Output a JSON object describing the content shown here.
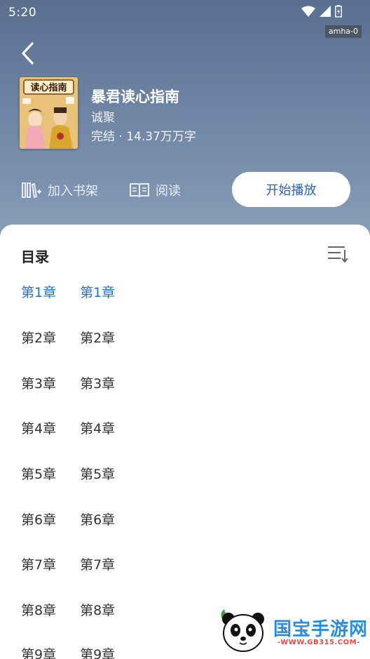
{
  "status": {
    "time": "5:20",
    "device_badge": "amha-0"
  },
  "book": {
    "title": "暴君读心指南",
    "author": "诚聚",
    "meta": "完结 · 14.37万万字",
    "cover_text": "读心指南"
  },
  "actions": {
    "shelf_label": "加入书架",
    "read_label": "阅读",
    "play_label": "开始播放"
  },
  "toc": {
    "title": "目录",
    "chapters": [
      {
        "num": "第1章",
        "name": "第1章",
        "active": true
      },
      {
        "num": "第2章",
        "name": "第2章"
      },
      {
        "num": "第3章",
        "name": "第3章"
      },
      {
        "num": "第4章",
        "name": "第4章"
      },
      {
        "num": "第5章",
        "name": "第5章"
      },
      {
        "num": "第6章",
        "name": "第6章"
      },
      {
        "num": "第7章",
        "name": "第7章"
      },
      {
        "num": "第8章",
        "name": "第8章"
      },
      {
        "num": "第9章",
        "name": "第9章"
      }
    ]
  },
  "watermark": {
    "text": "国宝手游网",
    "url": "-WWW.GB315.COM-"
  },
  "colors": {
    "accent": "#1f73d4",
    "play_text": "#2c62b5"
  }
}
